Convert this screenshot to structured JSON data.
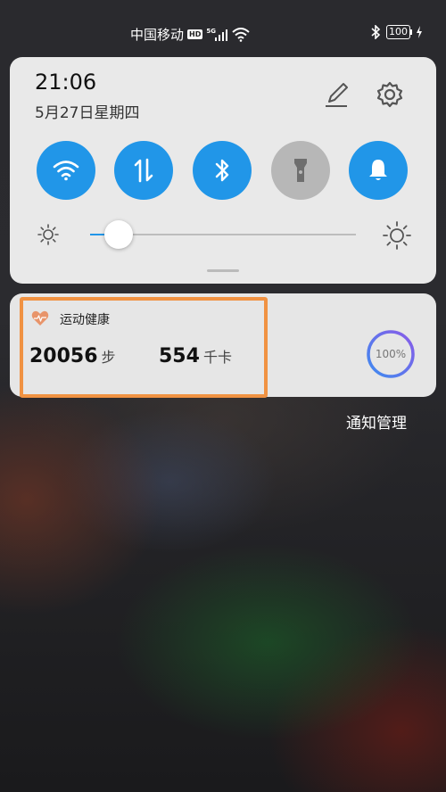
{
  "status_bar": {
    "carrier": "中国移动",
    "hd_badge": "HD",
    "network": "5G",
    "battery": "100"
  },
  "quick_panel": {
    "time": "21:06",
    "date": "5月27日星期四",
    "toggles": [
      {
        "name": "wifi",
        "icon": "wifi-icon",
        "state": "on"
      },
      {
        "name": "mobile-data",
        "icon": "data-arrows-icon",
        "state": "on"
      },
      {
        "name": "bluetooth",
        "icon": "bluetooth-icon",
        "state": "on"
      },
      {
        "name": "flashlight",
        "icon": "flashlight-icon",
        "state": "off"
      },
      {
        "name": "sound",
        "icon": "bell-icon",
        "state": "on"
      }
    ],
    "brightness_level": 0.08
  },
  "notification": {
    "app_name": "运动健康",
    "steps_value": "20056",
    "steps_unit": "步",
    "calories_value": "554",
    "calories_unit": "千卡",
    "progress_label": "100%",
    "progress": 1.0
  },
  "notification_management": "通知管理",
  "colors": {
    "accent": "#2196e8",
    "highlight": "#f09242",
    "heart": "#e8946a"
  }
}
